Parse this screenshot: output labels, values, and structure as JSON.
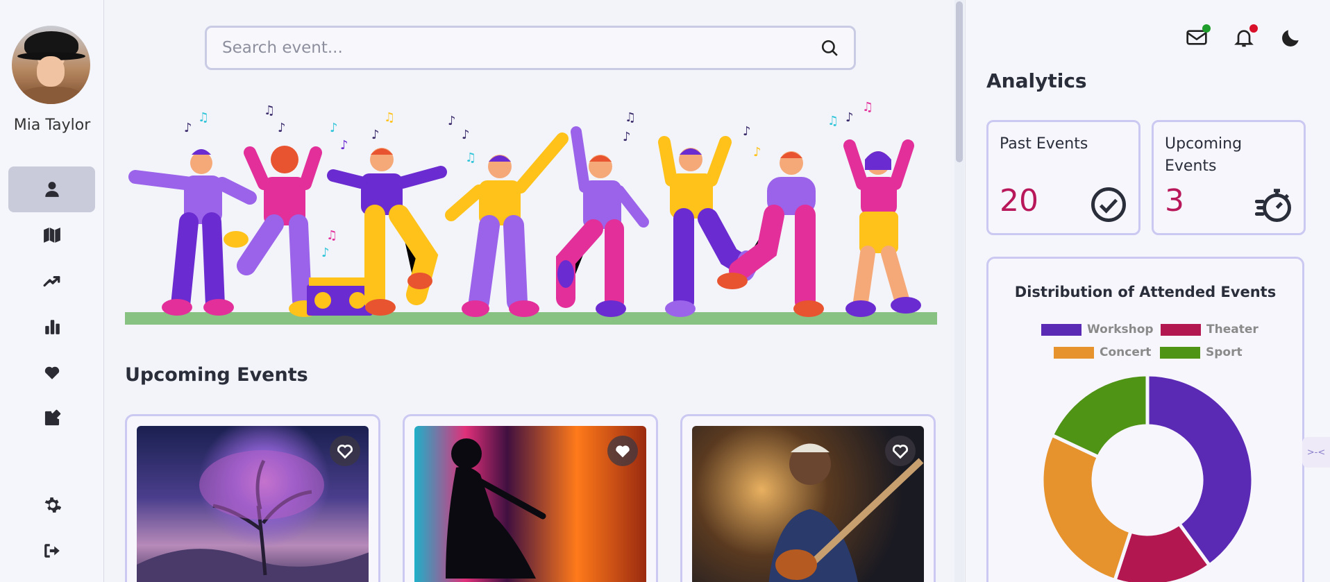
{
  "user": {
    "name": "Mia Taylor"
  },
  "search": {
    "placeholder": "Search event..."
  },
  "nav": {
    "items": [
      "user",
      "map",
      "trending",
      "stats",
      "favorites",
      "edit"
    ],
    "bottom": [
      "settings",
      "logout"
    ]
  },
  "main": {
    "section_title": "Upcoming Events",
    "cards": [
      {
        "image": "starry tree landscape",
        "favorited": false
      },
      {
        "image": "dancer silhouette neon",
        "favorited": true
      },
      {
        "image": "guitarist on stage",
        "favorited": false
      }
    ]
  },
  "right": {
    "title": "Analytics",
    "stats": [
      {
        "label": "Past Events",
        "value": "20",
        "icon": "check-circle-icon"
      },
      {
        "label": "Upcoming Events",
        "value": "3",
        "icon": "stopwatch-icon"
      }
    ],
    "side_tab": ">-<"
  },
  "colors": {
    "workshop": "#5b2ab4",
    "theater": "#b3174f",
    "concert": "#e6932e",
    "sport": "#4f9415",
    "accent_value": "#b8185a",
    "card_border": "#cbc8f2",
    "mail_dot": "#1f9e2c",
    "bell_dot": "#d9102a"
  },
  "chart_data": {
    "type": "pie",
    "title": "Distribution of Attended Events",
    "categories": [
      "Workshop",
      "Theater",
      "Concert",
      "Sport"
    ],
    "values": [
      40,
      15,
      27,
      18
    ],
    "legend": "top"
  }
}
